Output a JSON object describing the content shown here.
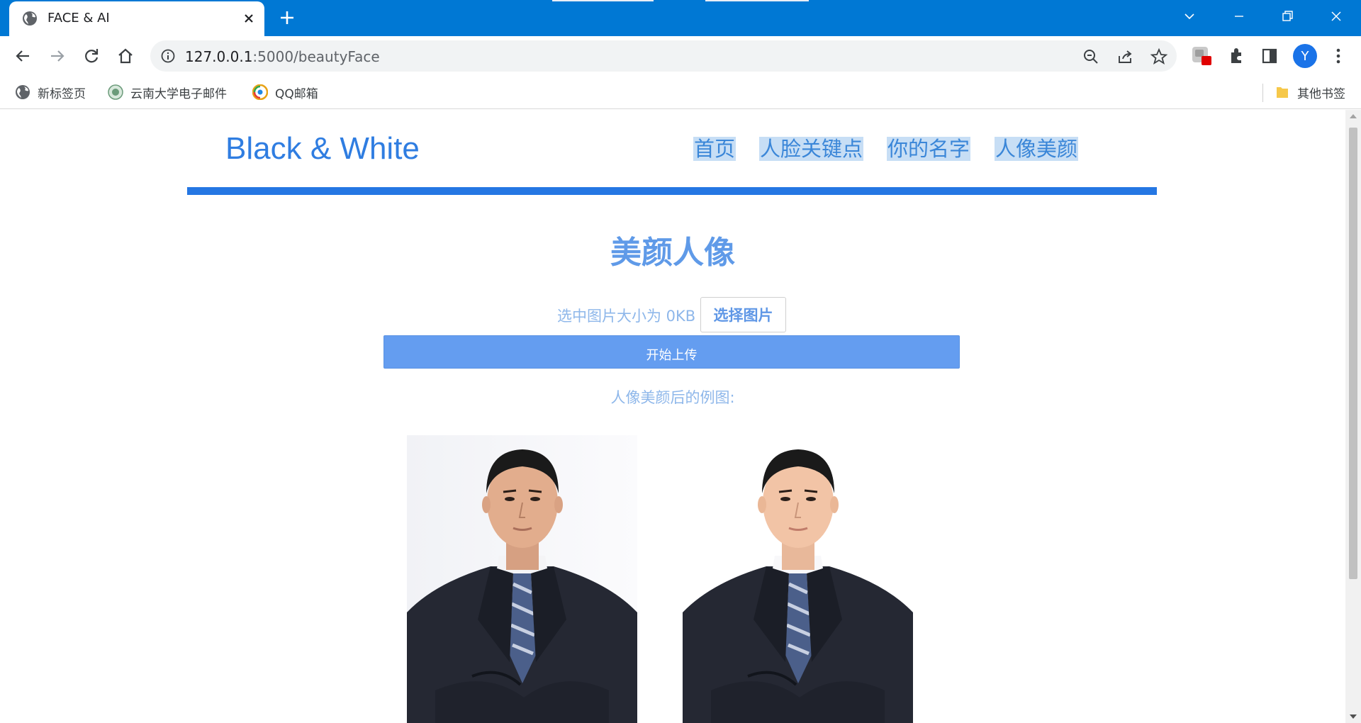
{
  "browser": {
    "tab": {
      "title": "FACE & AI",
      "favicon": "globe-icon"
    },
    "url": {
      "host": "127.0.0.1",
      "path": ":5000/beautyFace"
    },
    "profile_initial": "Y",
    "bookmarks": [
      {
        "label": "新标签页",
        "icon": "globe-icon"
      },
      {
        "label": "云南大学电子邮件",
        "icon": "university-seal-icon"
      },
      {
        "label": "QQ邮箱",
        "icon": "qq-mail-icon"
      }
    ],
    "other_bookmarks": "其他书签"
  },
  "site": {
    "brand": {
      "part1": "Black",
      "amp": "&",
      "part2": "White"
    },
    "nav": [
      "首页",
      "人脸关键点",
      "你的名字",
      "人像美颜"
    ]
  },
  "main": {
    "title": "美颜人像",
    "size_label": "选中图片大小为 0KB",
    "choose_button": "选择图片",
    "upload_button": "开始上传",
    "example_label": "人像美颜后的例图:"
  },
  "colors": {
    "chrome_blue": "#0078d4",
    "brand_blue": "#2f7de1",
    "rule_blue": "#2577e3",
    "title_blue": "#5f9ae8",
    "button_blue": "#649df0",
    "nav_highlight": "#c7def5"
  }
}
